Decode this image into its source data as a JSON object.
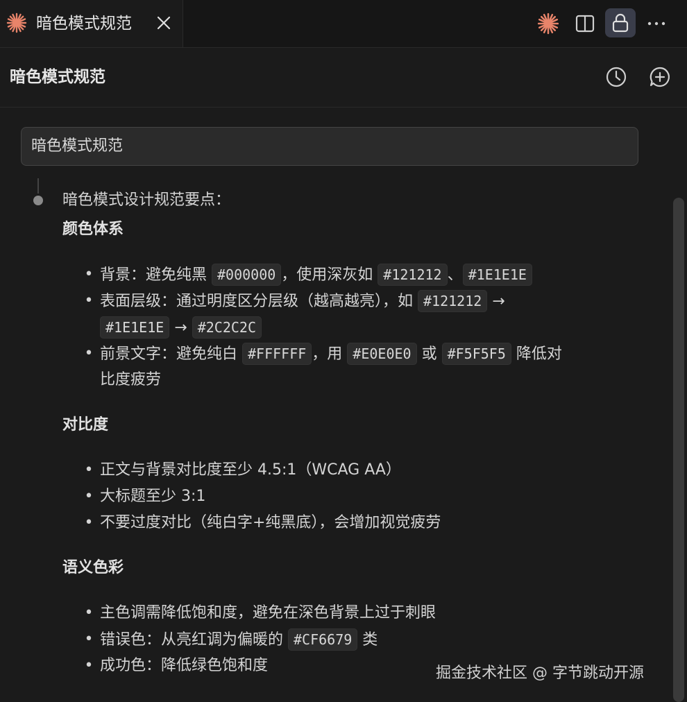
{
  "tab": {
    "title": "暗色模式规范"
  },
  "header": {
    "title": "暗色模式规范"
  },
  "input": {
    "value": "暗色模式规范"
  },
  "intro": "暗色模式设计规范要点：",
  "sections": [
    {
      "title": "颜色体系",
      "items": [
        {
          "lines": [
            [
              {
                "t": "背景：避免纯黑 "
              },
              {
                "c": "#000000"
              },
              {
                "t": "，使用深灰如 "
              },
              {
                "c": "#121212"
              },
              {
                "t": "、"
              },
              {
                "c": "#1E1E1E"
              }
            ]
          ]
        },
        {
          "lines": [
            [
              {
                "t": "表面层级：通过明度区分层级（越高越亮），如 "
              },
              {
                "c": "#121212"
              },
              {
                "t": " →"
              }
            ],
            [
              {
                "c": "#1E1E1E"
              },
              {
                "t": " → "
              },
              {
                "c": "#2C2C2C"
              }
            ]
          ]
        },
        {
          "lines": [
            [
              {
                "t": "前景文字：避免纯白 "
              },
              {
                "c": "#FFFFFF"
              },
              {
                "t": "，用 "
              },
              {
                "c": "#E0E0E0"
              },
              {
                "t": " 或 "
              },
              {
                "c": "#F5F5F5"
              },
              {
                "t": " 降低对"
              }
            ],
            [
              {
                "t": "比度疲劳"
              }
            ]
          ]
        }
      ]
    },
    {
      "title": "对比度",
      "items": [
        {
          "lines": [
            [
              {
                "t": "正文与背景对比度至少 4.5:1（WCAG AA）"
              }
            ]
          ]
        },
        {
          "lines": [
            [
              {
                "t": "大标题至少 3:1"
              }
            ]
          ]
        },
        {
          "lines": [
            [
              {
                "t": "不要过度对比（纯白字+纯黑底），会增加视觉疲劳"
              }
            ]
          ]
        }
      ]
    },
    {
      "title": "语义色彩",
      "items": [
        {
          "lines": [
            [
              {
                "t": "主色调需降低饱和度，避免在深色背景上过于刺眼"
              }
            ]
          ]
        },
        {
          "lines": [
            [
              {
                "t": "错误色：从亮红调为偏暖的 "
              },
              {
                "c": "#CF6679"
              },
              {
                "t": " 类"
              }
            ]
          ]
        },
        {
          "lines": [
            [
              {
                "t": "成功色：降低绿色饱和度"
              }
            ]
          ]
        }
      ]
    }
  ],
  "watermark": "掘金技术社区 @ 字节跳动开源",
  "colors": {
    "accent": "#e8846a",
    "background": "#1b1b1b",
    "surface": "#2b2b2b",
    "text": "#d4d4d4"
  },
  "icons": {
    "tab": "sparkle-icon",
    "close": "close-icon",
    "toolbar": [
      "sparkle-icon",
      "split-view-icon",
      "lock-icon",
      "more-icon"
    ],
    "header": [
      "history-icon",
      "new-chat-icon"
    ]
  }
}
